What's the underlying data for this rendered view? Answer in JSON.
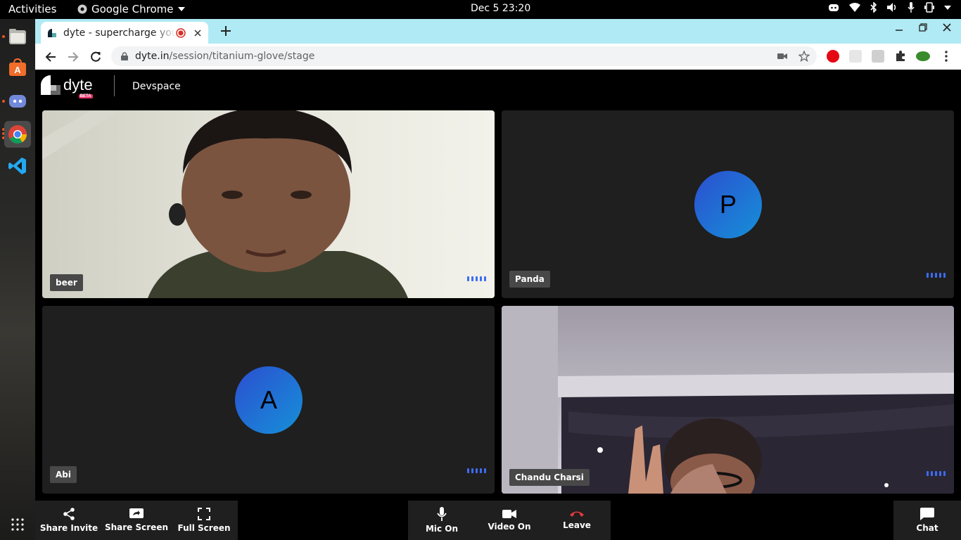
{
  "system": {
    "activities": "Activities",
    "app_name": "Google Chrome",
    "clock": "Dec 5  23:20"
  },
  "browser": {
    "tab_title": "dyte - supercharge you",
    "url_host": "dyte.in",
    "url_path": "/session/titanium-glove/stage"
  },
  "app": {
    "logo_text": "dyte",
    "logo_badge": "BETA",
    "room_name": "Devspace"
  },
  "participants": [
    {
      "name": "beer",
      "type": "video"
    },
    {
      "name": "Panda",
      "type": "avatar",
      "initial": "P"
    },
    {
      "name": "Abi",
      "type": "avatar",
      "initial": "A"
    },
    {
      "name": "Chandu Charsi",
      "type": "video"
    }
  ],
  "controls": {
    "left": [
      {
        "label": "Share Invite",
        "icon": "share-icon"
      },
      {
        "label": "Share Screen",
        "icon": "screen-share-icon"
      },
      {
        "label": "Full Screen",
        "icon": "fullscreen-icon"
      }
    ],
    "center": [
      {
        "label": "Mic On",
        "icon": "mic-icon"
      },
      {
        "label": "Video On",
        "icon": "video-camera-icon"
      },
      {
        "label": "Leave",
        "icon": "hang-up-icon"
      }
    ],
    "right": [
      {
        "label": "Chat",
        "icon": "chat-icon"
      }
    ]
  },
  "colors": {
    "accent": "#3d6cf5",
    "leave": "#e5383b",
    "tab_strip": "#b0eaf4"
  }
}
